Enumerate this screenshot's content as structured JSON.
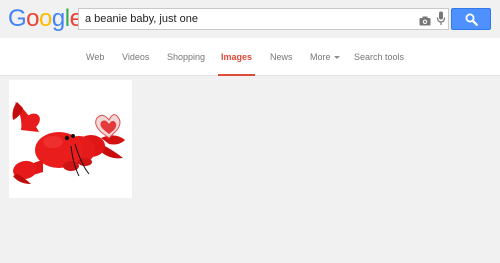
{
  "logo": {
    "letters": [
      "G",
      "o",
      "o",
      "g",
      "l",
      "e"
    ],
    "colors": [
      "#4285f4",
      "#ea4335",
      "#fbbc05",
      "#4285f4",
      "#34a853",
      "#ea4335"
    ]
  },
  "search": {
    "query": "a beanie baby, just one"
  },
  "icons": {
    "camera": "camera-icon",
    "mic": "microphone-icon",
    "search": "magnifier-icon"
  },
  "tabs": [
    {
      "label": "Web"
    },
    {
      "label": "Videos"
    },
    {
      "label": "Shopping"
    },
    {
      "label": "Images",
      "active": true
    },
    {
      "label": "News"
    },
    {
      "label": "More"
    },
    {
      "label": "Search tools"
    }
  ],
  "colors": {
    "accent": "#dd4b39",
    "search_button": "#4d90fe",
    "tab_text": "#777777"
  },
  "results": [
    {
      "subject": "red lobster beanie baby plush with heart tag"
    }
  ]
}
